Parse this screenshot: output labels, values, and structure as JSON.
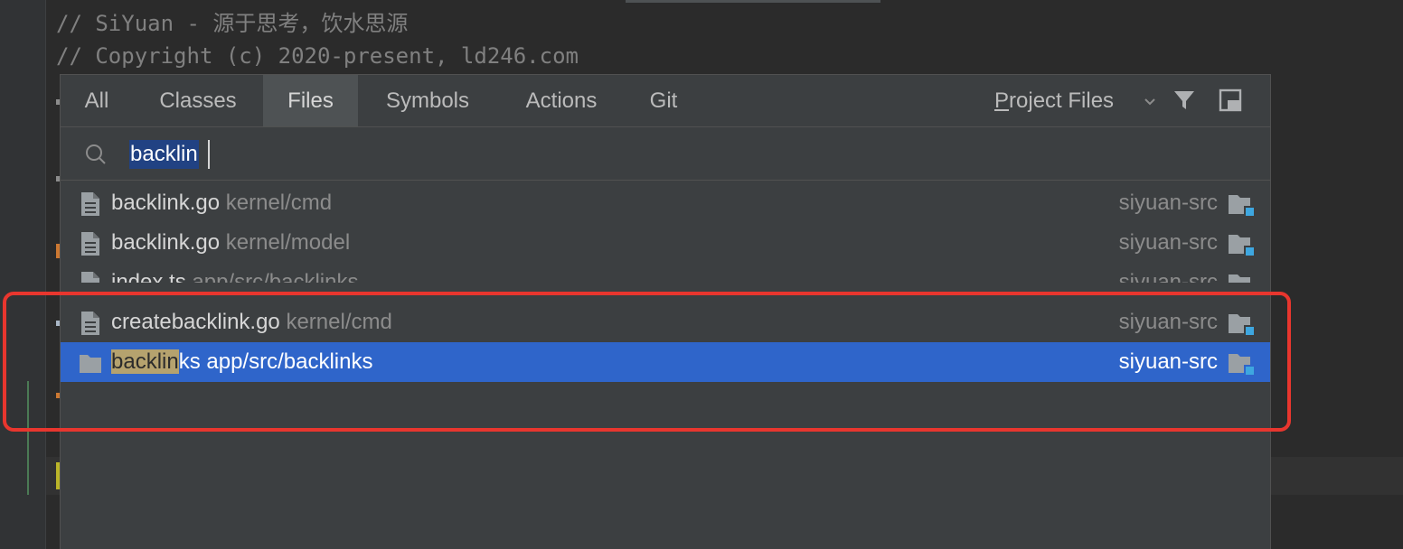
{
  "editor": {
    "lines": [
      "// SiYuan - 源于思考，饮水思源",
      "// Copyright (c) 2020-present, ld246.com"
    ]
  },
  "search_everywhere": {
    "tabs": [
      {
        "label": "All",
        "active": false
      },
      {
        "label": "Classes",
        "active": false
      },
      {
        "label": "Files",
        "active": true
      },
      {
        "label": "Symbols",
        "active": false
      },
      {
        "label": "Actions",
        "active": false
      },
      {
        "label": "Git",
        "active": false
      }
    ],
    "scope": {
      "mnemonic": "P",
      "rest": "roject Files"
    },
    "query": "backlin",
    "results": [
      {
        "icon": "go-file-icon",
        "name": "backlink.go",
        "path": "kernel/cmd",
        "project": "siyuan-src",
        "selected": false
      },
      {
        "icon": "go-file-icon",
        "name": "backlink.go",
        "path": "kernel/model",
        "project": "siyuan-src",
        "selected": false
      },
      {
        "icon": "ts-file-icon",
        "name": "index.ts",
        "path": "app/src/backlinks",
        "project": "siyuan-src",
        "selected": false
      },
      {
        "icon": "go-file-icon",
        "name": "createbacklink.go",
        "path": "kernel/cmd",
        "project": "siyuan-src",
        "selected": false
      },
      {
        "icon": "folder-icon",
        "name_match": "backlin",
        "name_rest": "ks",
        "path": "app/src/backlinks",
        "project": "siyuan-src",
        "selected": true
      }
    ]
  },
  "colors": {
    "selection": "#2f65ca",
    "annotation_box": "#e8362e",
    "match_highlight": "#b5a26e"
  }
}
